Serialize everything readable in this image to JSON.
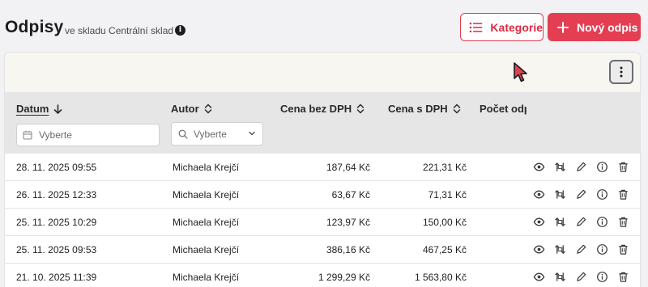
{
  "header": {
    "title": "Odpisy",
    "subtitle": "ve skladu Centrální sklad",
    "info_glyph": "i",
    "kategorie_label": "Kategorie",
    "novy_label": "Nový odpis"
  },
  "table": {
    "columns": {
      "datum": "Datum",
      "autor": "Autor",
      "cena_bez": "Cena bez DPH",
      "cena_s": "Cena s DPH",
      "pocet": "Počet odpisů"
    },
    "filters": {
      "date_placeholder": "Vyberte",
      "autor_placeholder": "Vyberte"
    },
    "rows": [
      {
        "datum": "28. 11. 2025 09:55",
        "autor": "Michaela Krejčí",
        "cena_bez": "187,64 Kč",
        "cena_s": "221,31 Kč"
      },
      {
        "datum": "26. 11. 2025 12:33",
        "autor": "Michaela Krejčí",
        "cena_bez": "63,67 Kč",
        "cena_s": "71,31 Kč"
      },
      {
        "datum": "25. 11. 2025 10:29",
        "autor": "Michaela Krejčí",
        "cena_bez": "123,97 Kč",
        "cena_s": "150,00 Kč"
      },
      {
        "datum": "25. 11. 2025 09:53",
        "autor": "Michaela Krejčí",
        "cena_bez": "386,16 Kč",
        "cena_s": "467,25 Kč"
      },
      {
        "datum": "21. 10. 2025 11:39",
        "autor": "Michaela Krejčí",
        "cena_bez": "1 299,29 Kč",
        "cena_s": "1 563,80 Kč"
      }
    ]
  },
  "icons": {
    "kategorie": "list-icon",
    "novy": "plus-icon",
    "menu": "kebab-menu-icon",
    "sort_down": "arrow-down-icon",
    "sort": "sort-icon",
    "calendar": "calendar-icon",
    "search": "search-icon",
    "view": "eye-icon",
    "transfer": "transfer-icon",
    "edit": "pencil-icon",
    "detail": "info-icon",
    "delete": "trash-icon"
  },
  "colors": {
    "brand": "#e43e52",
    "background": "#f2f2f4",
    "header_row": "#e6e6e6"
  }
}
